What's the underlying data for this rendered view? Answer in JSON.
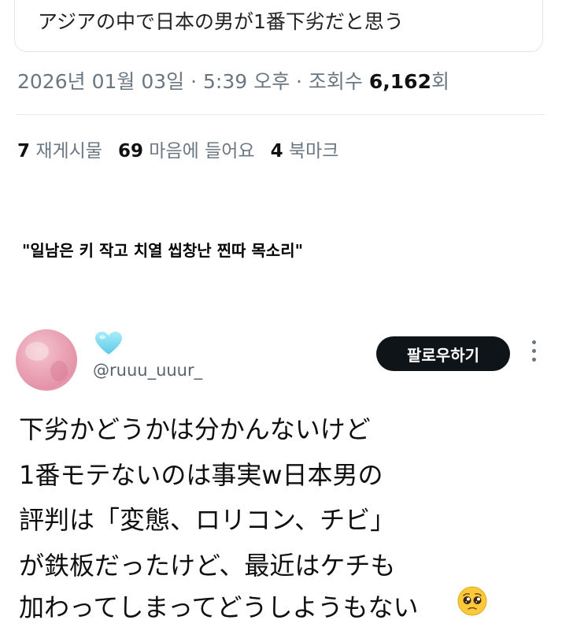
{
  "quoted_tweet": {
    "text": "アジアの中で日本の男が1番下劣だと思う"
  },
  "meta": {
    "date": "2026년 01월 03일",
    "separator": " · ",
    "time": "5:39 오후",
    "views_label": "조회수",
    "views_count": "6,162",
    "views_unit": "회"
  },
  "stats": {
    "reposts_count": "7",
    "reposts_label": "재게시물",
    "likes_count": "69",
    "likes_label": "마음에 들어요",
    "bookmarks_count": "4",
    "bookmarks_label": "북마크"
  },
  "caption": "\"일남은 키 작고 치열 씹창난 찐따 목소리\"",
  "reply": {
    "display_name_icon": "light-blue-heart-icon",
    "handle": "@ruuu_uuur_",
    "follow_label": "팔로우하기",
    "lines": [
      "下劣かどうかは分かんないけど",
      "1番モテないのは事実w日本男の",
      "評判は「変態、ロリコン、チビ」",
      "が鉄板だったけど、最近はケチも",
      "加わってしまってどうしようもない"
    ],
    "end_emoji_icon": "pleading-face-icon"
  },
  "colors": {
    "follow_button_bg": "#0f1419",
    "heart": "#7fd8ef",
    "muted_text": "#6b7780",
    "avatar_pink": "#eaa3b4"
  }
}
